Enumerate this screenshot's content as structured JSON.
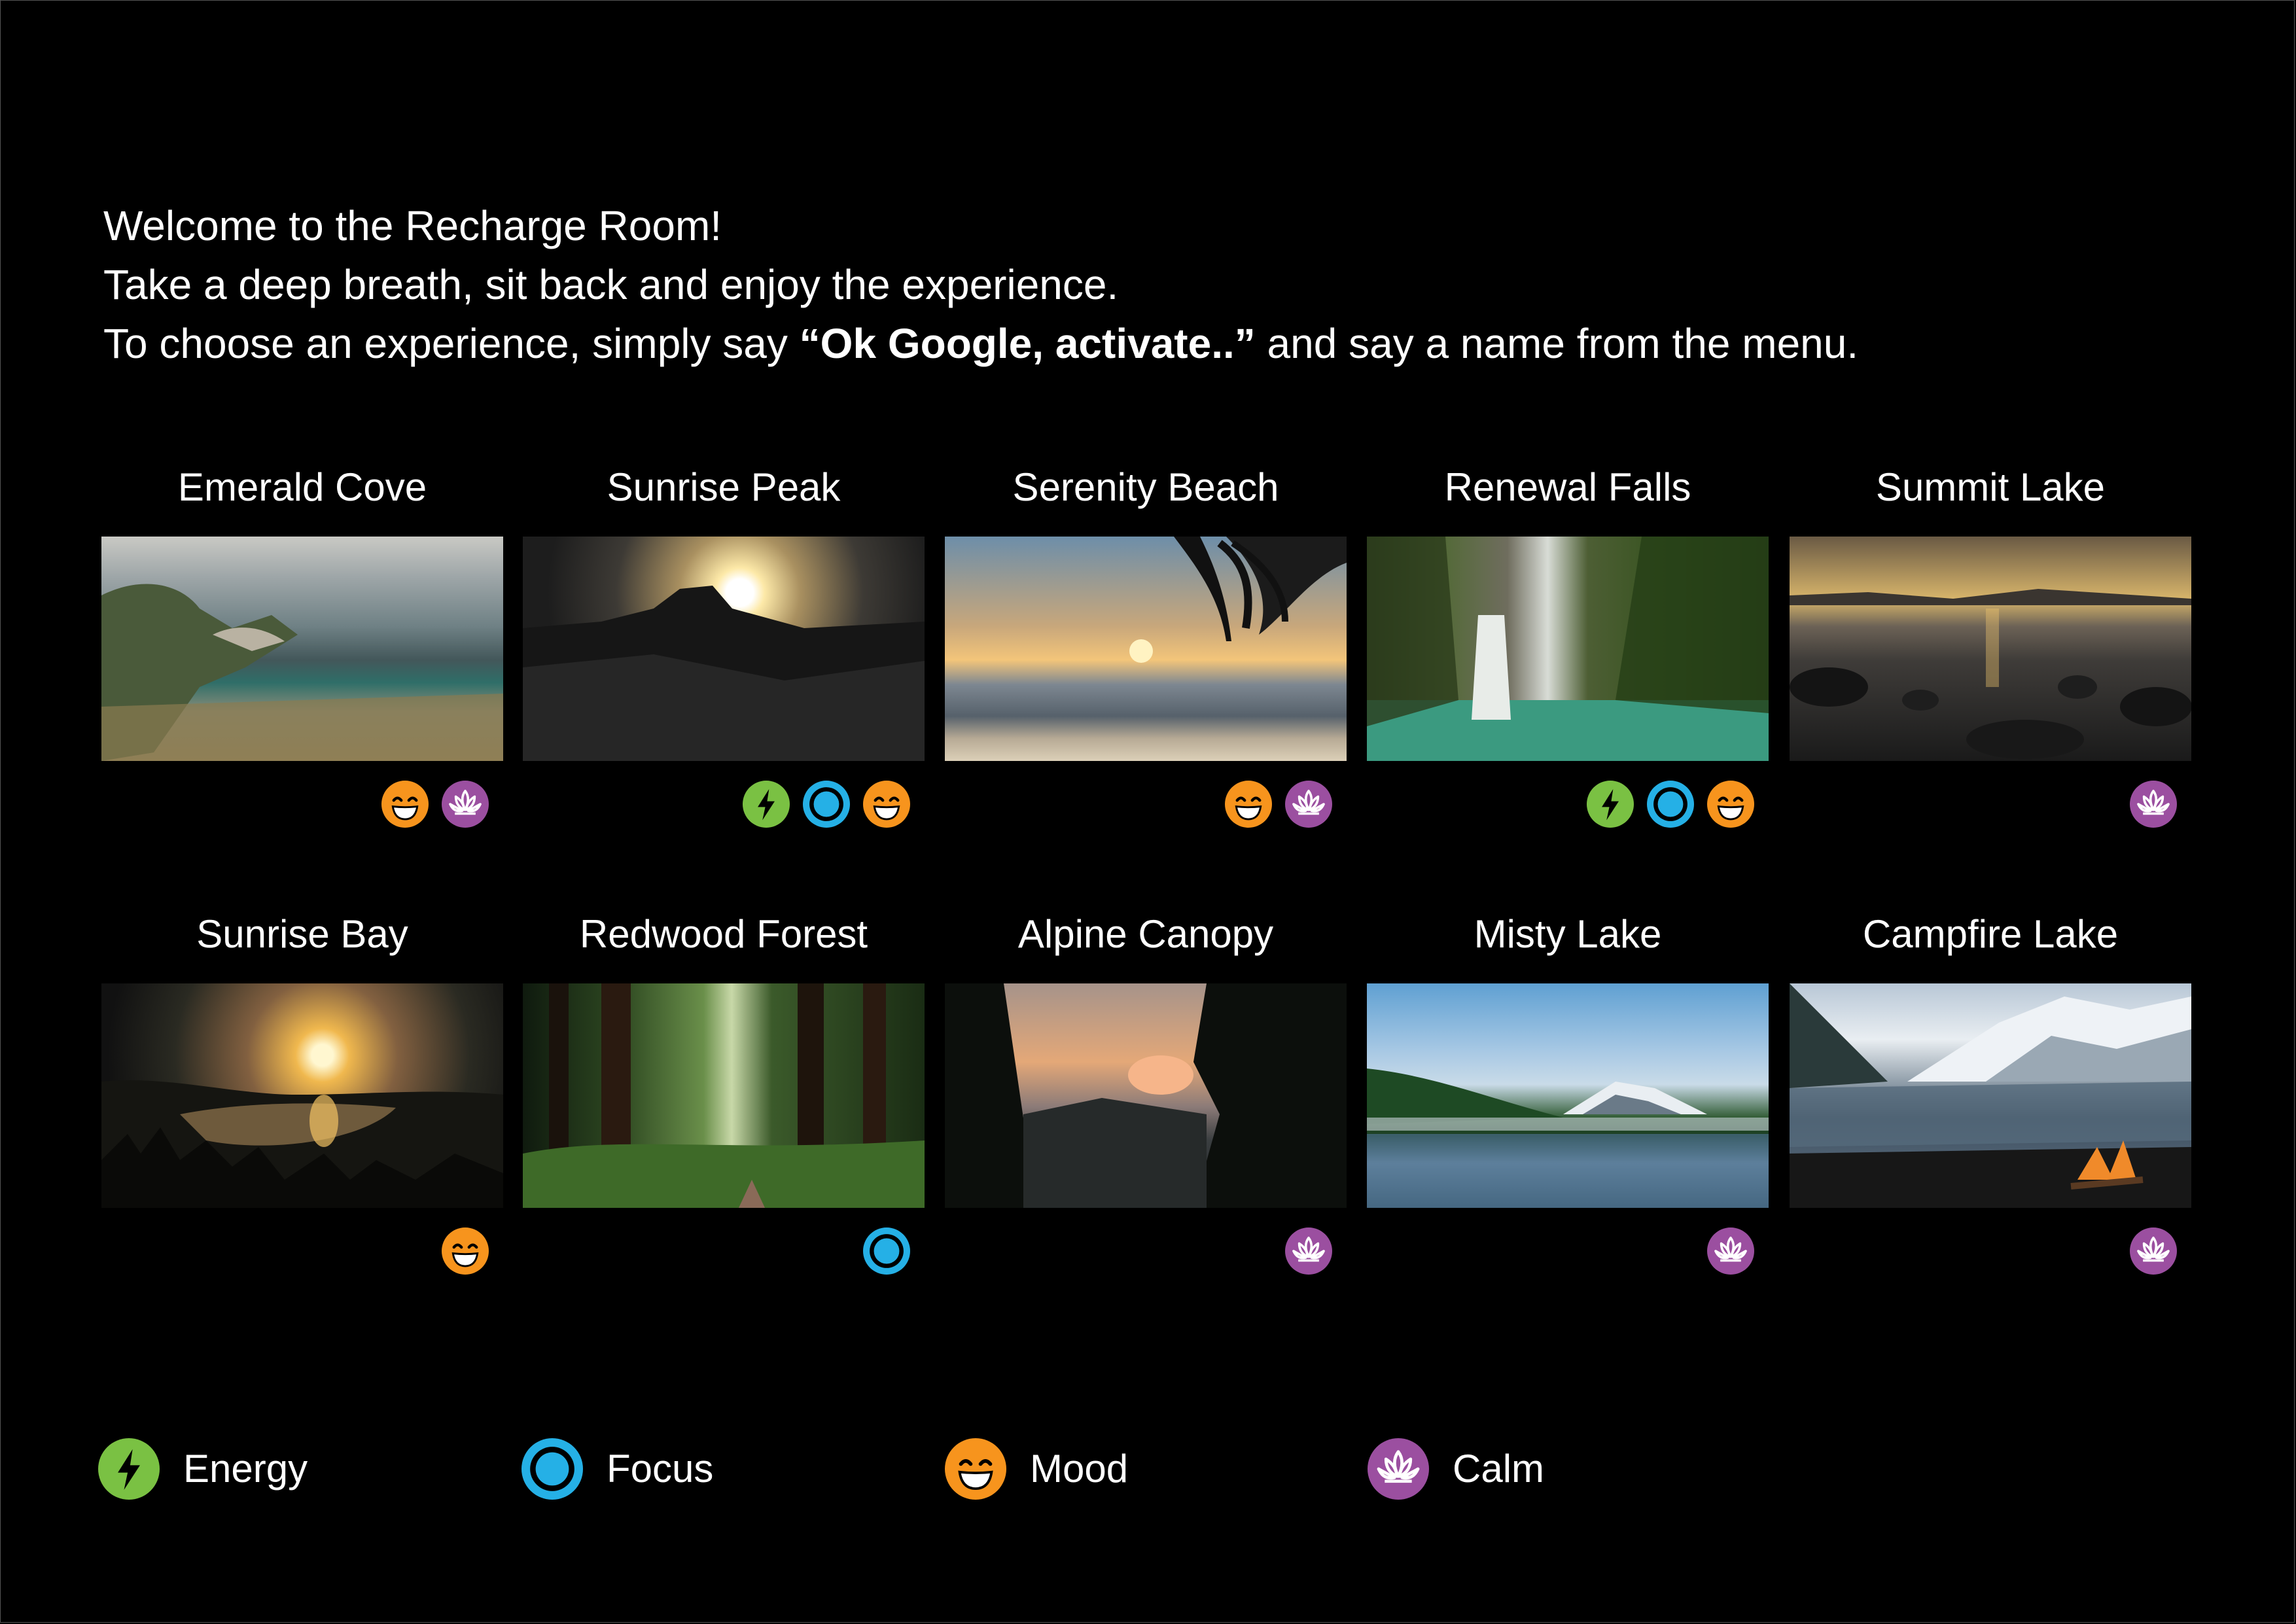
{
  "intro": {
    "line1": "Welcome to the Recharge Room!",
    "line2": "Take a deep breath, sit back and enjoy the experience.",
    "line3_before": "To choose an experience, simply say ",
    "line3_bold": "“Ok Google, activate..”",
    "line3_after": " and say a name from the menu."
  },
  "experiences": [
    {
      "title": "Emerald Cove",
      "tags": [
        "Mood",
        "Calm"
      ]
    },
    {
      "title": "Sunrise Peak",
      "tags": [
        "Energy",
        "Focus",
        "Mood"
      ]
    },
    {
      "title": "Serenity Beach",
      "tags": [
        "Mood",
        "Calm"
      ]
    },
    {
      "title": "Renewal Falls",
      "tags": [
        "Energy",
        "Focus",
        "Mood"
      ]
    },
    {
      "title": "Summit Lake",
      "tags": [
        "Calm"
      ]
    },
    {
      "title": "Sunrise Bay",
      "tags": [
        "Mood"
      ]
    },
    {
      "title": "Redwood Forest",
      "tags": [
        "Focus"
      ]
    },
    {
      "title": "Alpine Canopy",
      "tags": [
        "Calm"
      ]
    },
    {
      "title": "Misty Lake",
      "tags": [
        "Calm"
      ]
    },
    {
      "title": "Campfire Lake",
      "tags": [
        "Calm"
      ]
    }
  ],
  "legend": [
    {
      "label": "Energy",
      "icon": "lightning-bolt-icon",
      "color": "#7ac143"
    },
    {
      "label": "Focus",
      "icon": "target-ring-icon",
      "color": "#25b0e6"
    },
    {
      "label": "Mood",
      "icon": "smiley-face-icon",
      "color": "#f7941d"
    },
    {
      "label": "Calm",
      "icon": "lotus-flower-icon",
      "color": "#9b4fa0"
    }
  ]
}
